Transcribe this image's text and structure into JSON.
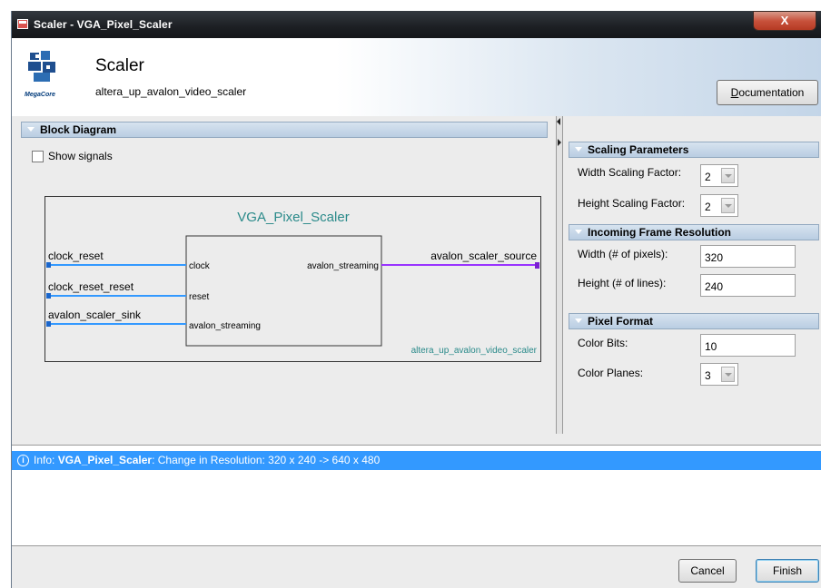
{
  "window": {
    "title": "Scaler - VGA_Pixel_Scaler",
    "close_label": "X"
  },
  "header": {
    "logo_text": "MegaCore",
    "component_name": "Scaler",
    "component_id": "altera_up_avalon_video_scaler",
    "documentation_button": "Documentation",
    "documentation_accel": "D",
    "documentation_rest": "ocumentation"
  },
  "block_diagram": {
    "section_title": "Block Diagram",
    "show_signals_label": "Show signals",
    "show_signals_checked": false,
    "instance_name": "VGA_Pixel_Scaler",
    "module_name": "altera_up_avalon_video_scaler",
    "left_interfaces": [
      {
        "name": "clock_reset",
        "port": "clock"
      },
      {
        "name": "clock_reset_reset",
        "port": "reset"
      },
      {
        "name": "avalon_scaler_sink",
        "port": "avalon_streaming"
      }
    ],
    "right_interfaces": [
      {
        "name": "avalon_scaler_source",
        "port": "avalon_streaming"
      }
    ],
    "colors": {
      "input_line": "#3399ff",
      "output_line": "#9933ff",
      "title": "#2a8a8a"
    }
  },
  "parameters": {
    "scaling": {
      "section_title": "Scaling Parameters",
      "width_label": "Width Scaling Factor:",
      "width_value": "2",
      "height_label": "Height Scaling Factor:",
      "height_value": "2"
    },
    "resolution": {
      "section_title": "Incoming Frame Resolution",
      "width_label": "Width (# of pixels):",
      "width_value": "320",
      "height_label": "Height (# of lines):",
      "height_value": "240"
    },
    "pixel_format": {
      "section_title": "Pixel Format",
      "color_bits_label": "Color Bits:",
      "color_bits_value": "10",
      "color_planes_label": "Color Planes:",
      "color_planes_value": "3"
    }
  },
  "messages": {
    "info_prefix": "Info: ",
    "info_instance": "VGA_Pixel_Scaler",
    "info_text": ": Change in Resolution: 320 x 240 -> 640 x 480",
    "highlight_color": "#3399ff"
  },
  "footer": {
    "cancel_label": "Cancel",
    "finish_label": "Finish"
  }
}
